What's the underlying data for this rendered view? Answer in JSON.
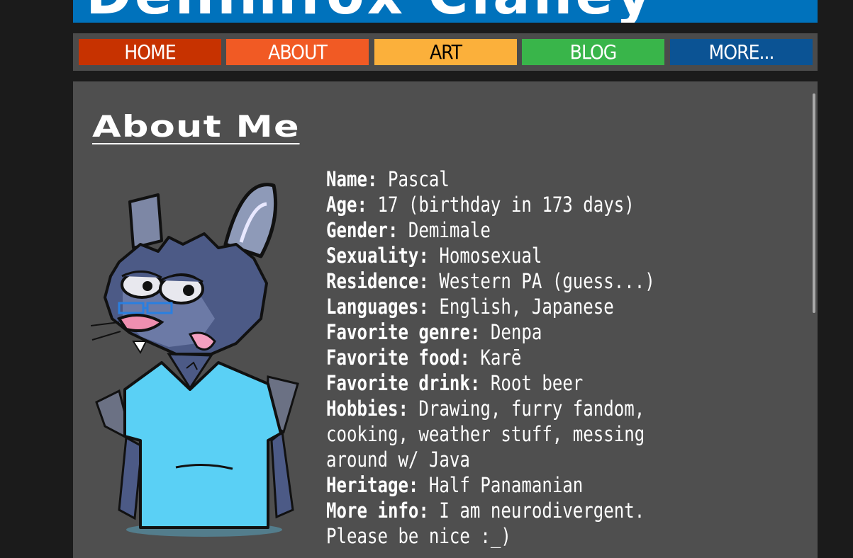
{
  "banner": {
    "title": "Denimfox Claney"
  },
  "nav": {
    "items": [
      {
        "label": "HOME"
      },
      {
        "label": "ABOUT"
      },
      {
        "label": "ART"
      },
      {
        "label": "BLOG"
      },
      {
        "label": "MORE..."
      }
    ]
  },
  "colors": {
    "home": "#c73200",
    "about": "#f15a24",
    "art": "#fbb03b",
    "blog": "#39b54a",
    "more": "#0b5394",
    "banner": "#0072bc"
  },
  "about": {
    "heading": "About Me",
    "rows": [
      {
        "label": "Name:",
        "value": " Pascal"
      },
      {
        "label": "Age:",
        "value": " 17 (birthday in 173 days)"
      },
      {
        "label": "Gender:",
        "value": " Demimale"
      },
      {
        "label": "Sexuality:",
        "value": " Homosexual"
      },
      {
        "label": "Residence:",
        "value": " Western PA (guess...)"
      },
      {
        "label": "Languages:",
        "value": " English, Japanese"
      },
      {
        "label": "Favorite genre:",
        "value": " Denpa"
      },
      {
        "label": "Favorite food:",
        "value": " Karē"
      },
      {
        "label": "Favorite drink:",
        "value": " Root beer"
      },
      {
        "label": "Hobbies:",
        "value": " Drawing, furry fandom, cooking, weather stuff, messing around w/ Java"
      },
      {
        "label": "Heritage:",
        "value": " Half Panamanian"
      },
      {
        "label": "More info:",
        "value": " I am neurodivergent. Please be nice :_)"
      }
    ]
  }
}
